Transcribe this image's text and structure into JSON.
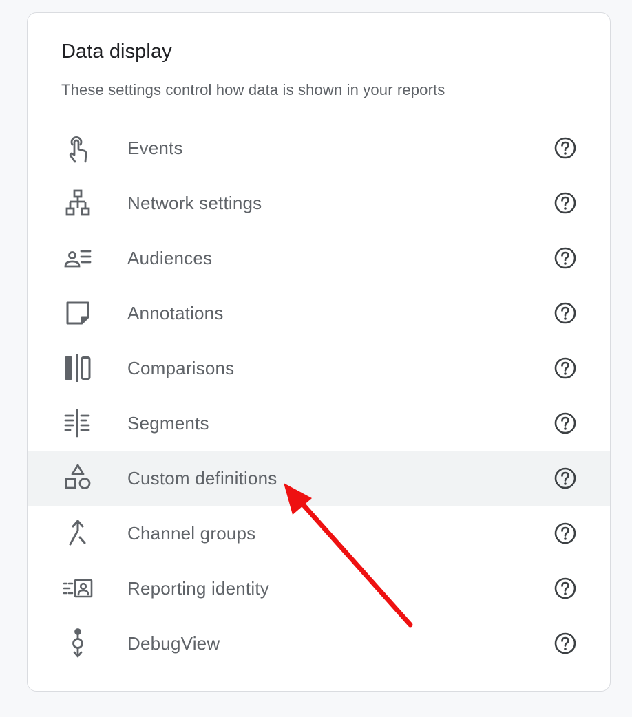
{
  "card": {
    "title": "Data display",
    "subtitle": "These settings control how data is shown in your reports"
  },
  "items": [
    {
      "label": "Events",
      "icon": "touch-icon"
    },
    {
      "label": "Network settings",
      "icon": "network-icon"
    },
    {
      "label": "Audiences",
      "icon": "audiences-icon"
    },
    {
      "label": "Annotations",
      "icon": "sticky-note-icon"
    },
    {
      "label": "Comparisons",
      "icon": "compare-columns-icon"
    },
    {
      "label": "Segments",
      "icon": "segments-icon"
    },
    {
      "label": "Custom definitions",
      "icon": "shapes-icon",
      "highlighted": true
    },
    {
      "label": "Channel groups",
      "icon": "merge-icon"
    },
    {
      "label": "Reporting identity",
      "icon": "identity-icon"
    },
    {
      "label": "DebugView",
      "icon": "debug-icon"
    }
  ],
  "help_icon": "help-circle-icon",
  "annotation": {
    "type": "arrow",
    "color": "#ee1111",
    "points_to": "Custom definitions"
  },
  "colors": {
    "text_primary": "#202124",
    "text_secondary": "#5f6368",
    "icon": "#5f6368",
    "highlight_bg": "#f1f3f4",
    "card_border": "#dadce0",
    "page_bg": "#f7f8fa"
  }
}
